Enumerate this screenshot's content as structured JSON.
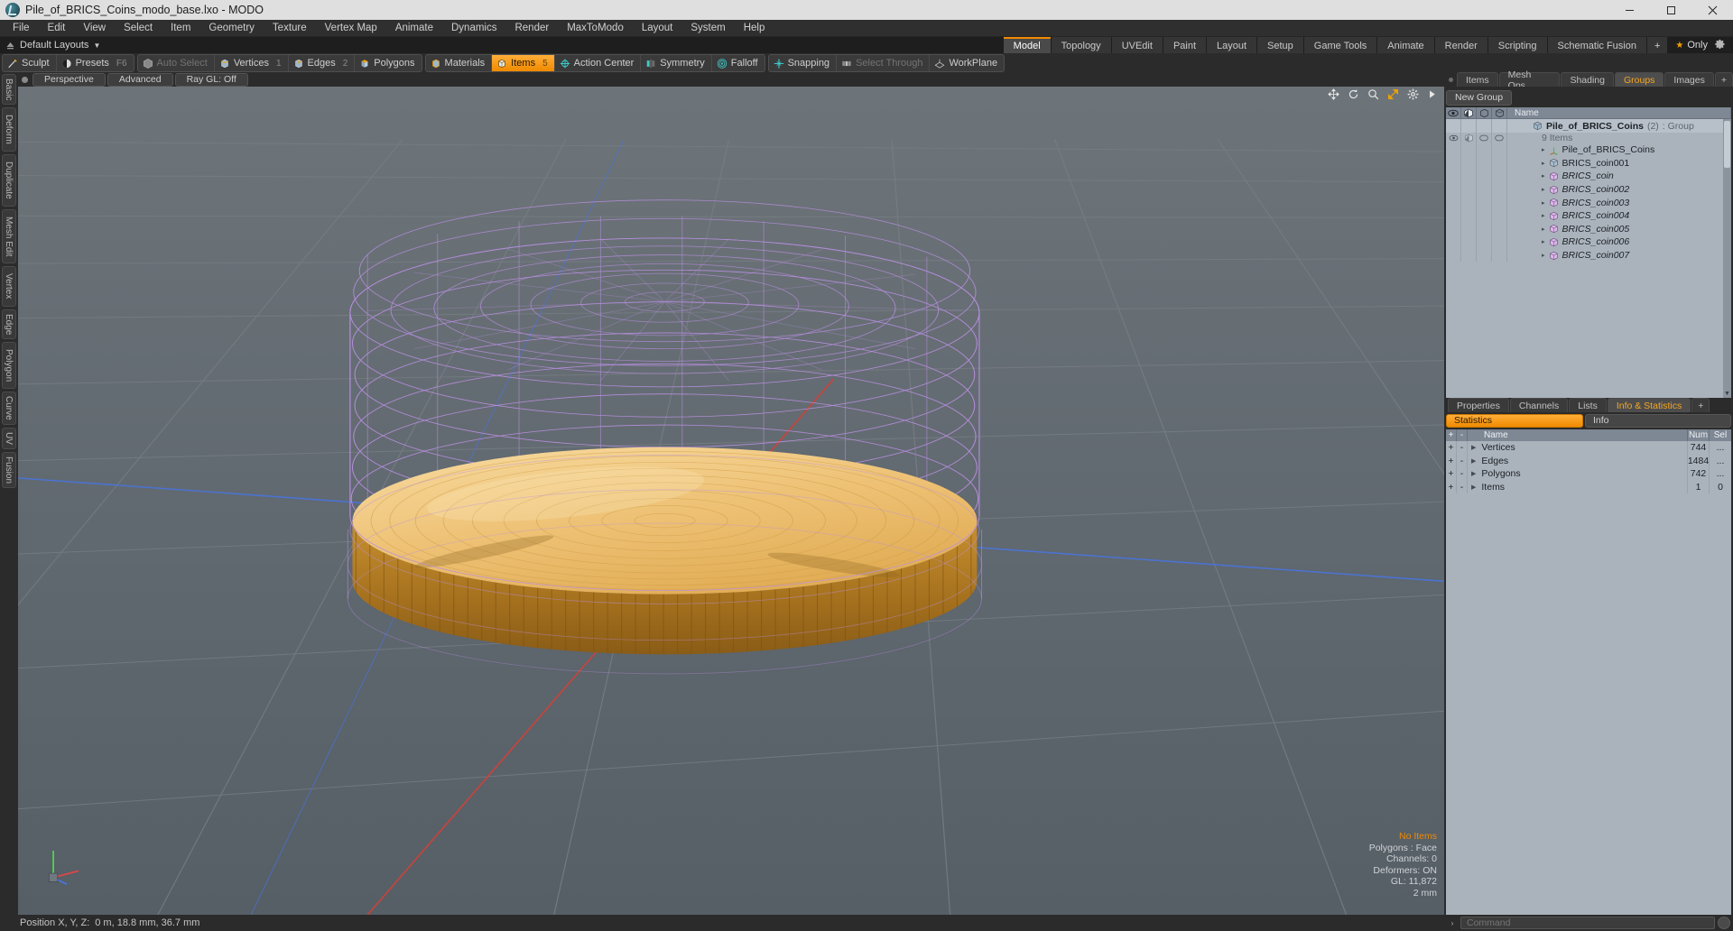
{
  "titlebar": {
    "title": "Pile_of_BRICS_Coins_modo_base.lxo - MODO",
    "app_icon": "modo-icon",
    "minimize": "minimize-icon",
    "maximize": "maximize-icon",
    "close": "close-icon"
  },
  "menubar": {
    "items": [
      {
        "label": "File"
      },
      {
        "label": "Edit"
      },
      {
        "label": "View"
      },
      {
        "label": "Select"
      },
      {
        "label": "Item"
      },
      {
        "label": "Geometry"
      },
      {
        "label": "Texture"
      },
      {
        "label": "Vertex Map"
      },
      {
        "label": "Animate"
      },
      {
        "label": "Dynamics"
      },
      {
        "label": "Render"
      },
      {
        "label": "MaxToModo"
      },
      {
        "label": "Layout"
      },
      {
        "label": "System"
      },
      {
        "label": "Help"
      }
    ]
  },
  "layoutbar": {
    "preset_label": "Default Layouts",
    "tabs": [
      {
        "label": "Model",
        "active": true
      },
      {
        "label": "Topology",
        "active": false
      },
      {
        "label": "UVEdit",
        "active": false
      },
      {
        "label": "Paint",
        "active": false
      },
      {
        "label": "Layout",
        "active": false
      },
      {
        "label": "Setup",
        "active": false
      },
      {
        "label": "Game Tools",
        "active": false
      },
      {
        "label": "Animate",
        "active": false
      },
      {
        "label": "Render",
        "active": false
      },
      {
        "label": "Scripting",
        "active": false
      },
      {
        "label": "Schematic Fusion",
        "active": false
      },
      {
        "label": "+",
        "active": false
      }
    ],
    "only_label": "Only",
    "config_icon": "gear-icon"
  },
  "toolbar": {
    "groups": [
      {
        "items": [
          {
            "label": "Sculpt",
            "icon": "brush-icon",
            "hotkey": "",
            "state": "normal"
          },
          {
            "label": "Presets",
            "icon": "sphere-icon",
            "hotkey": "F6",
            "state": "normal"
          }
        ]
      },
      {
        "items": [
          {
            "label": "Auto Select",
            "icon": "cube-gray-icon",
            "hotkey": "",
            "state": "disabled"
          },
          {
            "label": "Vertices",
            "icon": "vertex-icon",
            "hotkey": "1",
            "state": "normal"
          },
          {
            "label": "Edges",
            "icon": "edge-icon",
            "hotkey": "2",
            "state": "normal"
          },
          {
            "label": "Polygons",
            "icon": "polygon-icon",
            "hotkey": "",
            "state": "normal"
          }
        ]
      },
      {
        "items": [
          {
            "label": "Materials",
            "icon": "material-icon",
            "hotkey": "",
            "state": "normal"
          },
          {
            "label": "Items",
            "icon": "items-icon",
            "hotkey": "5",
            "state": "active"
          },
          {
            "label": "Action Center",
            "icon": "action-center-icon",
            "hotkey": "",
            "state": "normal"
          },
          {
            "label": "Symmetry",
            "icon": "symmetry-icon",
            "hotkey": "",
            "state": "normal"
          },
          {
            "label": "Falloff",
            "icon": "falloff-icon",
            "hotkey": "",
            "state": "normal"
          }
        ]
      },
      {
        "items": [
          {
            "label": "Snapping",
            "icon": "snap-icon",
            "hotkey": "",
            "state": "normal"
          },
          {
            "label": "Select Through",
            "icon": "select-through-icon",
            "hotkey": "",
            "state": "disabled"
          },
          {
            "label": "WorkPlane",
            "icon": "workplane-icon",
            "hotkey": "",
            "state": "normal"
          }
        ]
      }
    ]
  },
  "left_tabs": [
    {
      "label": "Basic"
    },
    {
      "label": "Deform"
    },
    {
      "label": "Duplicate"
    },
    {
      "label": "Mesh Edit"
    },
    {
      "label": "Vertex"
    },
    {
      "label": "Edge"
    },
    {
      "label": "Polygon"
    },
    {
      "label": "Curve"
    },
    {
      "label": "UV"
    },
    {
      "label": "Fusion"
    }
  ],
  "viewport": {
    "buttons": [
      {
        "label": "Perspective",
        "name": "viewport-perspective-button"
      },
      {
        "label": "Advanced",
        "name": "viewport-shading-button"
      },
      {
        "label": "Ray GL: Off",
        "name": "viewport-raygl-button"
      }
    ],
    "tools": [
      {
        "icon": "move-icon",
        "name": "viewport-pan-icon"
      },
      {
        "icon": "rotate-icon",
        "name": "viewport-rotate-icon"
      },
      {
        "icon": "zoom-icon",
        "name": "viewport-zoom-icon"
      },
      {
        "icon": "fit-icon",
        "name": "viewport-fit-icon"
      },
      {
        "icon": "gear-icon",
        "name": "viewport-options-icon"
      },
      {
        "icon": "play-icon",
        "name": "viewport-expand-icon"
      }
    ],
    "stats": {
      "no_items": "No Items",
      "polygons": "Polygons : Face",
      "channels": "Channels: 0",
      "deformers": "Deformers: ON",
      "gl": "GL: 11,872",
      "scale": "2 mm"
    }
  },
  "statusbar": {
    "position_label": "Position X, Y, Z:",
    "position_value": "0 m, 18.8 mm, 36.7 mm"
  },
  "right_panel": {
    "top_tabs": [
      {
        "label": "Items",
        "active": false
      },
      {
        "label": "Mesh Ops",
        "active": false
      },
      {
        "label": "Shading",
        "active": false
      },
      {
        "label": "Groups",
        "active": true
      },
      {
        "label": "Images",
        "active": false
      },
      {
        "label": "+",
        "active": false
      }
    ],
    "new_group_button": "New Group",
    "tree_columns": [
      "Name"
    ],
    "tree": {
      "group": {
        "name": "Pile_of_BRICS_Coins",
        "count": "(2)",
        "type": ": Group",
        "sub_label": "9 Items"
      },
      "items": [
        {
          "label": "Pile_of_BRICS_Coins",
          "icon": "locator-icon",
          "italic": false
        },
        {
          "label": "BRICS_coin001",
          "icon": "mesh-icon-blue",
          "italic": false
        },
        {
          "label": "BRICS_coin",
          "icon": "mesh-icon-pink",
          "italic": true
        },
        {
          "label": "BRICS_coin002",
          "icon": "mesh-icon-pink",
          "italic": true
        },
        {
          "label": "BRICS_coin003",
          "icon": "mesh-icon-pink",
          "italic": true
        },
        {
          "label": "BRICS_coin004",
          "icon": "mesh-icon-pink",
          "italic": true
        },
        {
          "label": "BRICS_coin005",
          "icon": "mesh-icon-pink",
          "italic": true
        },
        {
          "label": "BRICS_coin006",
          "icon": "mesh-icon-pink",
          "italic": true
        },
        {
          "label": "BRICS_coin007",
          "icon": "mesh-icon-pink",
          "italic": true
        }
      ]
    },
    "bottom_tabs": [
      {
        "label": "Properties",
        "active": false
      },
      {
        "label": "Channels",
        "active": false
      },
      {
        "label": "Lists",
        "active": false
      },
      {
        "label": "Info & Statistics",
        "active": true
      },
      {
        "label": "+",
        "active": false
      }
    ],
    "stat_subtabs": [
      {
        "label": "Statistics",
        "active": true
      },
      {
        "label": "Info",
        "active": false
      }
    ],
    "stat_columns": {
      "plus": "+",
      "minus": "-",
      "name": "Name",
      "num": "Num",
      "sel": "Sel"
    },
    "stat_rows": [
      {
        "name": "Vertices",
        "num": "744",
        "sel": "..."
      },
      {
        "name": "Edges",
        "num": "1484",
        "sel": "..."
      },
      {
        "name": "Polygons",
        "num": "742",
        "sel": "..."
      },
      {
        "name": "Items",
        "num": "1",
        "sel": "0"
      }
    ]
  },
  "command_bar": {
    "placeholder": "Command",
    "prompt": "›"
  },
  "colors": {
    "accent": "#f08a00",
    "panel_bg": "#2b2b2b",
    "tree_bg": "#aab3bc",
    "wire_purple": "#c9a3e8",
    "coin_gold": "#e8b659"
  }
}
